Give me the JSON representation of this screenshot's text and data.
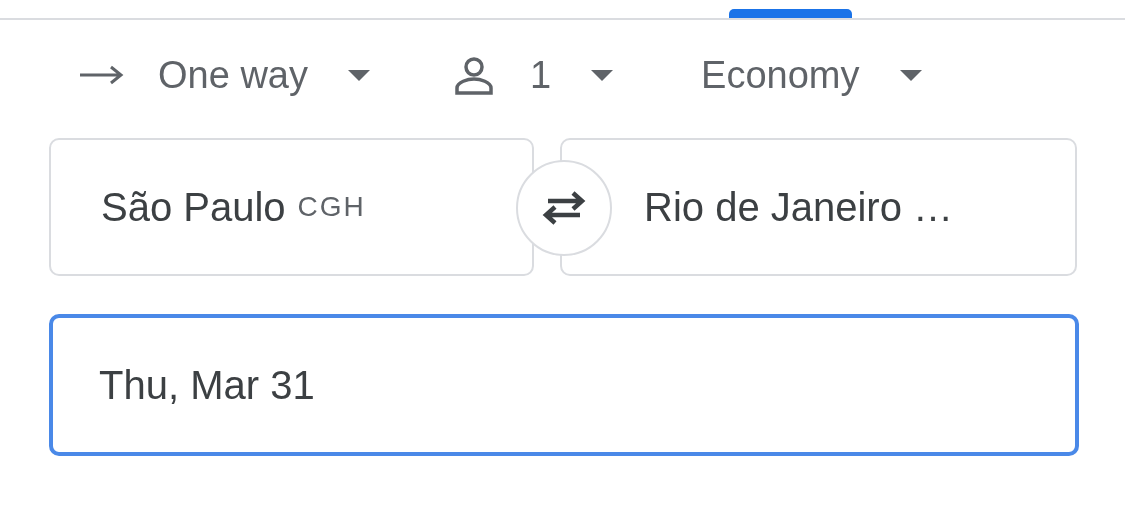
{
  "trip_options": [
    {
      "kind": "trip-type",
      "label": "One way"
    },
    {
      "kind": "passengers",
      "label": "1"
    },
    {
      "kind": "cabin-class",
      "label": "Economy"
    }
  ],
  "origin": {
    "city": "São Paulo",
    "code": "CGH"
  },
  "destination": {
    "city": "Rio de Janeiro …"
  },
  "date": {
    "value": "Thu, Mar 31",
    "focused": true
  }
}
